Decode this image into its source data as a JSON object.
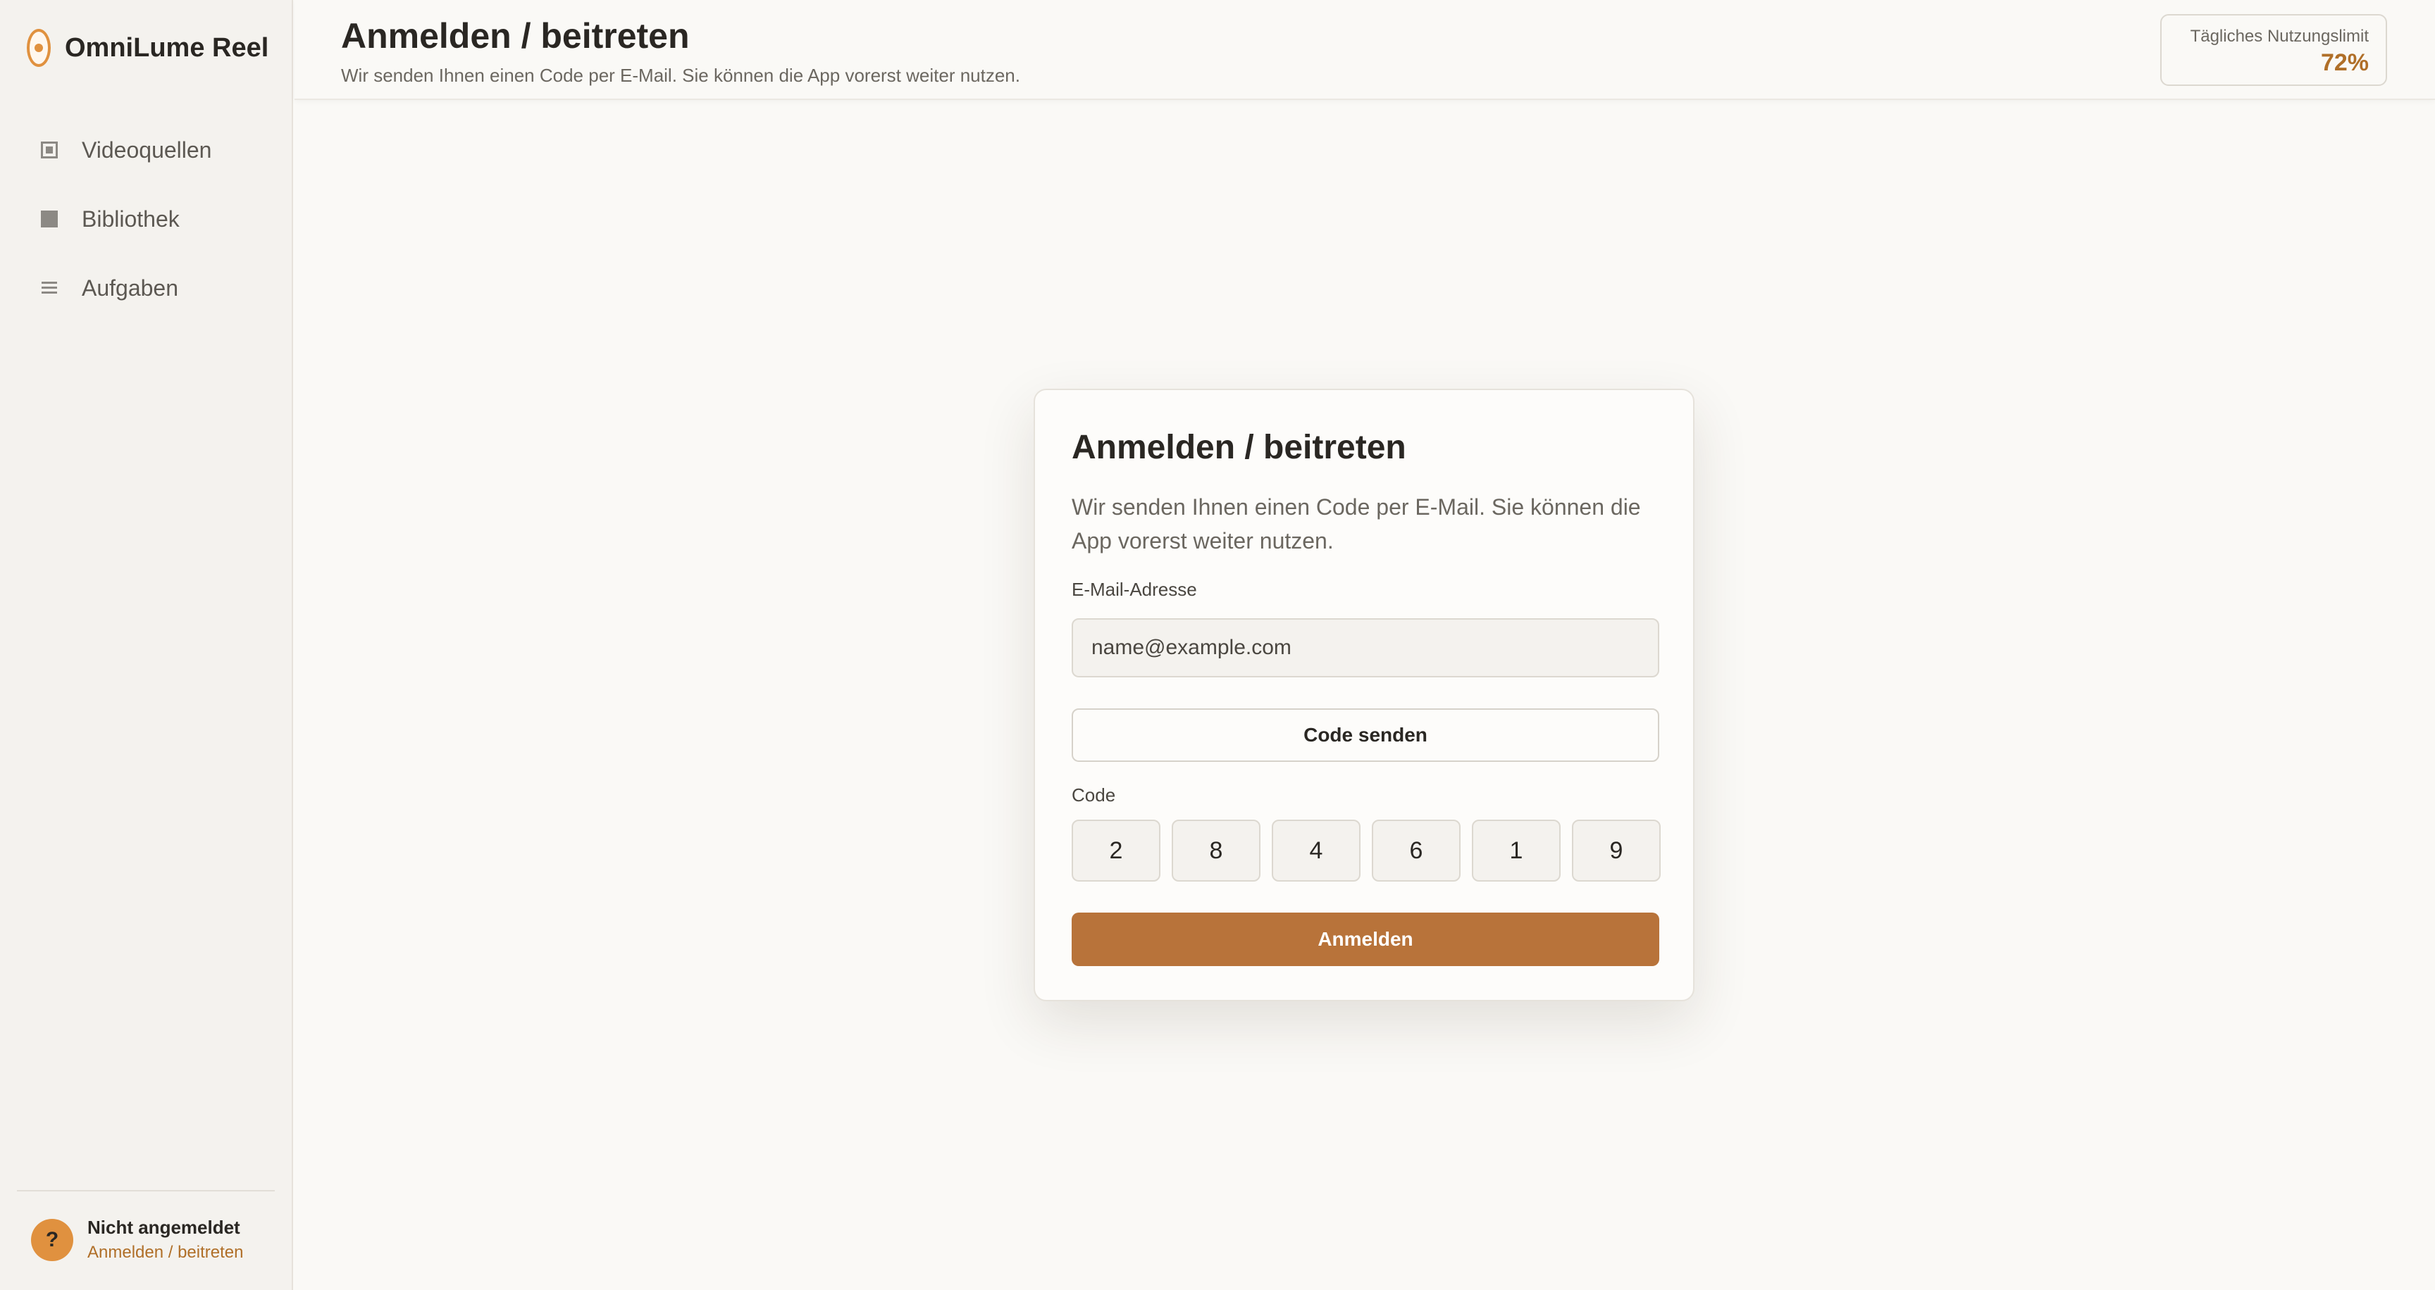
{
  "app": {
    "name": "OmniLume Reel",
    "logo_icon": "omnilume-logo-icon",
    "accent_color": "#b8733a"
  },
  "sidebar": {
    "items": [
      {
        "label": "Videoquellen",
        "icon": "video-frame-icon"
      },
      {
        "label": "Bibliothek",
        "icon": "library-square-icon"
      },
      {
        "label": "Aufgaben",
        "icon": "task-list-icon"
      }
    ],
    "footer": {
      "avatar_glyph": "?",
      "status": "Nicht angemeldet",
      "link": "Anmelden / beitreten"
    }
  },
  "header": {
    "title": "Anmelden / beitreten",
    "subtitle": "Wir senden Ihnen einen Code per E-Mail. Sie können die App vorerst weiter nutzen.",
    "usage": {
      "label": "Tägliches Nutzungslimit",
      "value": "72%"
    }
  },
  "card": {
    "title": "Anmelden / beitreten",
    "description": "Wir senden Ihnen einen Code per E-Mail. Sie können die App vorerst weiter nutzen.",
    "email_label": "E-Mail-Adresse",
    "email_value": "",
    "email_placeholder": "name@example.com",
    "send_button": "Code senden",
    "code_label": "Code",
    "code_digits": [
      "2",
      "8",
      "4",
      "6",
      "1",
      "9"
    ],
    "submit_button": "Anmelden"
  }
}
